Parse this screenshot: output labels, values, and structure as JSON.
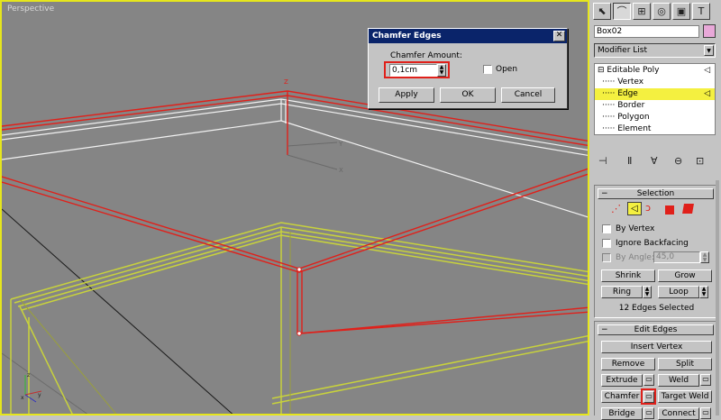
{
  "viewport": {
    "label": "Perspective"
  },
  "dialog": {
    "title": "Chamfer Edges",
    "amount_label": "Chamfer Amount:",
    "amount_value": "0,1cm",
    "open_label": "Open",
    "apply_label": "Apply",
    "ok_label": "OK",
    "cancel_label": "Cancel"
  },
  "panel": {
    "object_name": "Box02",
    "object_color": "#e8a8d8",
    "modifier_list": "Modifier List",
    "stack": [
      {
        "label": "Editable Poly",
        "prefix": "⊟"
      },
      {
        "label": "Vertex",
        "prefix": "·····"
      },
      {
        "label": "Edge",
        "prefix": "·····"
      },
      {
        "label": "Border",
        "prefix": "·····"
      },
      {
        "label": "Polygon",
        "prefix": "·····"
      },
      {
        "label": "Element",
        "prefix": "·····"
      }
    ],
    "selection": {
      "header": "Selection",
      "by_vertex": "By Vertex",
      "ignore_backfacing": "Ignore Backfacing",
      "by_angle": "By Angle:",
      "angle_value": "45,0",
      "shrink": "Shrink",
      "grow": "Grow",
      "ring": "Ring",
      "loop": "Loop",
      "status": "12 Edges Selected"
    },
    "edit_edges": {
      "header": "Edit Edges",
      "insert_vertex": "Insert Vertex",
      "remove": "Remove",
      "split": "Split",
      "extrude": "Extrude",
      "weld": "Weld",
      "chamfer": "Chamfer",
      "target_weld": "Target Weld",
      "bridge": "Bridge",
      "connect": "Connect"
    }
  },
  "colors": {
    "viewport_border": "#e6e61c",
    "selected_edges": "#e0201a",
    "highlight": "#f4f040"
  }
}
